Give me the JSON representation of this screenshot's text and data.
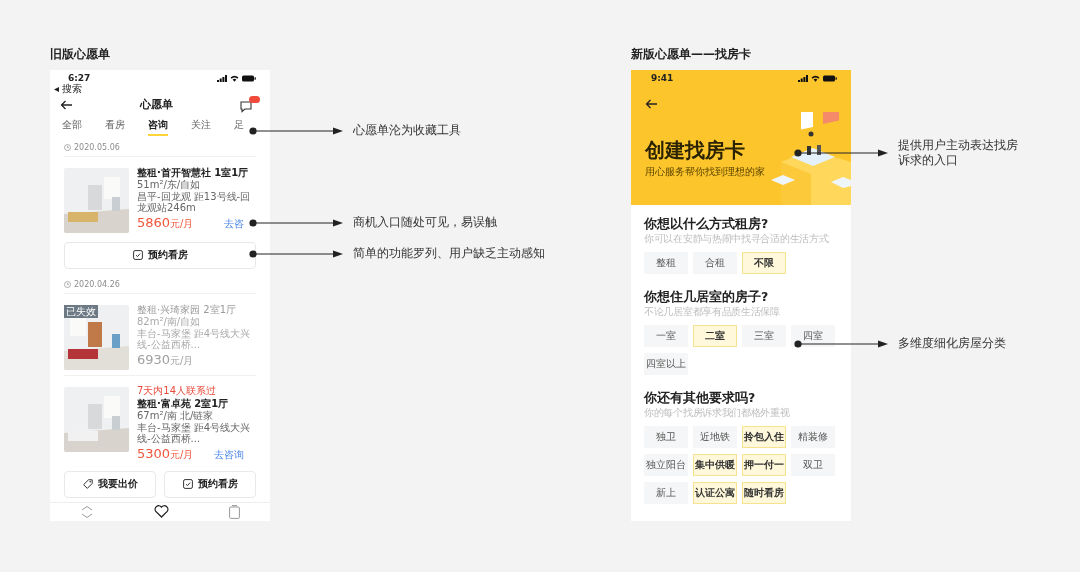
{
  "old_version": {
    "heading": "旧版心愿单",
    "status_bar": {
      "time": "6:27",
      "back_link": "◂ 搜索"
    },
    "title": "心愿单",
    "tabs": [
      {
        "label": "全部",
        "selected": false
      },
      {
        "label": "看房",
        "selected": false
      },
      {
        "label": "咨询",
        "selected": true
      },
      {
        "label": "关注",
        "selected": false
      },
      {
        "label": "足",
        "selected": false
      }
    ],
    "groups": [
      {
        "date": "2020.05.06",
        "listings": [
          {
            "title": "整租·首开智慧社 1室1厅",
            "spec": "51m²/东/自如",
            "location": "昌平-回龙观 距13号线-回龙观站246m",
            "price": "5860",
            "unit": "元/月",
            "expired": false,
            "action": "去咨",
            "buttons": [
              {
                "label": "预约看房",
                "kind": "booking"
              }
            ]
          }
        ]
      },
      {
        "date": "2020.04.26",
        "listings": [
          {
            "badge": "已失效",
            "title": "整租·兴琦家园 2室1厅",
            "spec": "82m²/南/自如",
            "location": "丰台-马家堡 距4号线大兴线-公益西桥...",
            "price": "6930",
            "unit": "元/月",
            "expired": true
          },
          {
            "notice": "7天内14人联系过",
            "title": "整租·富卓苑 2室1厅",
            "spec": "67m²/南 北/链家",
            "location": "丰台-马家堡 距4号线大兴线-公益西桥...",
            "price": "5300",
            "unit": "元/月",
            "expired": false,
            "action": "去咨询",
            "buttons": [
              {
                "label": "我要出价",
                "kind": "offer"
              },
              {
                "label": "预约看房",
                "kind": "booking"
              }
            ]
          }
        ]
      }
    ],
    "annotations": [
      "心愿单沦为收藏工具",
      "商机入口随处可见，易误触",
      "简单的功能罗列、用户缺乏主动感知"
    ]
  },
  "new_version": {
    "heading": "新版心愿单——找房卡",
    "status_bar": {
      "time": "9:41"
    },
    "hero": {
      "title": "创建找房卡",
      "subtitle": "用心服务帮你找到理想的家"
    },
    "questions": [
      {
        "title": "你想以什么方式租房?",
        "hint": "你可以在安静与热闹中找寻合适的生活方式",
        "options": [
          {
            "label": "整租",
            "selected": false
          },
          {
            "label": "合租",
            "selected": false
          },
          {
            "label": "不限",
            "selected": true
          }
        ]
      },
      {
        "title": "你想住几居室的房子?",
        "hint": "不论几居室都享有品质生活保障",
        "options": [
          {
            "label": "一室",
            "selected": false
          },
          {
            "label": "二室",
            "selected": true
          },
          {
            "label": "三室",
            "selected": false
          },
          {
            "label": "四室",
            "selected": false
          },
          {
            "label": "四室以上",
            "selected": false
          }
        ]
      },
      {
        "title": "你还有其他要求吗?",
        "hint": "你的每个找房诉求我们都格外重视",
        "options": [
          {
            "label": "独卫",
            "selected": false
          },
          {
            "label": "近地铁",
            "selected": false
          },
          {
            "label": "拎包入住",
            "selected": true
          },
          {
            "label": "精装修",
            "selected": false
          },
          {
            "label": "独立阳台",
            "selected": false
          },
          {
            "label": "集中供暖",
            "selected": true
          },
          {
            "label": "押一付一",
            "selected": true
          },
          {
            "label": "双卫",
            "selected": false
          },
          {
            "label": "新上",
            "selected": false
          },
          {
            "label": "认证公寓",
            "selected": true
          },
          {
            "label": "随时看房",
            "selected": true
          }
        ]
      }
    ],
    "annotations": [
      "提供用户主动表达找房诉求的入口",
      "多维度细化房屋分类"
    ]
  }
}
